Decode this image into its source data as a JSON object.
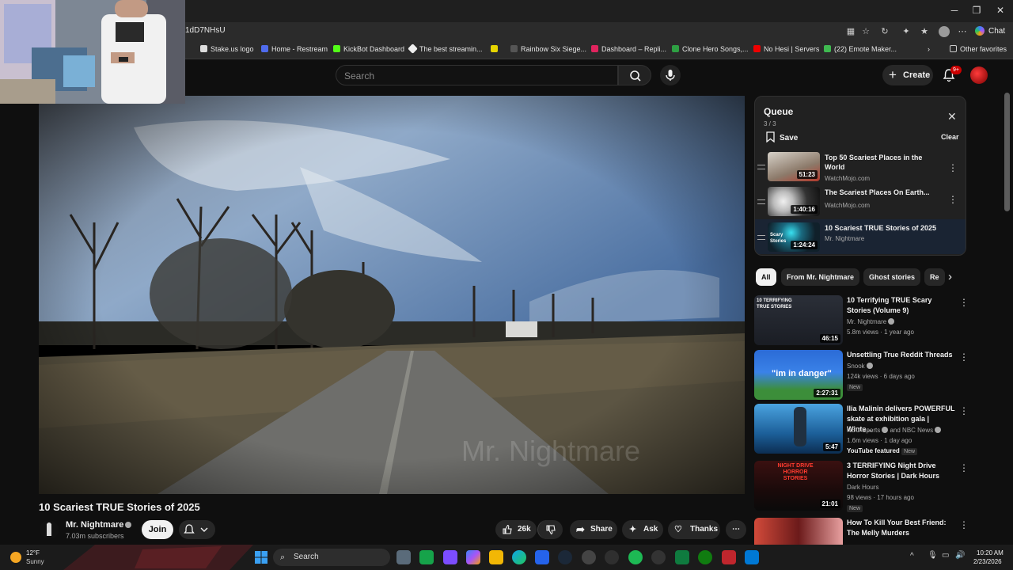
{
  "browser": {
    "url": "1dD7NHsU",
    "chat_label": "Chat",
    "bookmarks": [
      "Stake.us logo",
      "Home - Restream",
      "KickBot Dashboard",
      "The best streamin...",
      "Rainbow Six Siege...",
      "Dashboard – Repli...",
      "Clone Hero Songs,...",
      "No Hesi | Servers",
      "(22) Emote Maker...",
      "Other favorites"
    ]
  },
  "youtube": {
    "search_placeholder": "Search",
    "create_label": "Create",
    "notification_count": "9+"
  },
  "video": {
    "title": "10 Scariest TRUE Stories of 2025",
    "watermark": "Mr. Nightmare",
    "channel_name": "Mr. Nightmare",
    "subscribers": "7.03m subscribers",
    "join_label": "Join",
    "likes": "26k",
    "share_label": "Share",
    "ask_label": "Ask",
    "thanks_label": "Thanks"
  },
  "queue": {
    "title": "Queue",
    "count": "3 / 3",
    "save_label": "Save",
    "clear_label": "Clear",
    "items": [
      {
        "title": "Top 50 Scariest Places in the World",
        "channel": "WatchMojo.com",
        "duration": "51:23"
      },
      {
        "title": "The Scariest Places On Earth...",
        "channel": "WatchMojo.com",
        "duration": "1:40:16"
      },
      {
        "title": "10 Scariest TRUE Stories of 2025",
        "channel": "Mr. Nightmare",
        "duration": "1:24:24",
        "thumb_text": "Scary Stories"
      }
    ]
  },
  "chips": [
    "All",
    "From Mr. Nightmare",
    "Ghost stories",
    "Re"
  ],
  "recommendations": [
    {
      "title": "10 Terrifying TRUE Scary Stories (Volume 9)",
      "channel": "Mr. Nightmare",
      "meta": "5.8m views · 1 year ago",
      "duration": "46:15",
      "thumb_text": "10 TERRIFYING TRUE STORIES"
    },
    {
      "title": "Unsettling True Reddit Threads",
      "channel": "Snook",
      "meta": "124k views · 6 days ago",
      "badge": "New",
      "duration": "2:27:31",
      "thumb_text": "\"im in danger\""
    },
    {
      "title": "Ilia Malinin delivers POWERFUL skate at exhibition gala | Winte...",
      "channel": "NBC Sports",
      "channel_extra": "and NBC News",
      "meta": "1.6m views · 1 day ago",
      "badge_label": "YouTube featured",
      "badge": "New",
      "duration": "5:47"
    },
    {
      "title": "3 TERRIFYING Night Drive Horror Stories | Dark Hours",
      "channel": "Dark Hours",
      "meta": "98 views · 17 hours ago",
      "badge": "New",
      "duration": "21:01",
      "thumb_text": "NIGHT DRIVE HORROR STORIES"
    },
    {
      "title": "How To Kill Your Best Friend: The Melly Murders",
      "channel": "",
      "meta": ""
    }
  ],
  "taskbar": {
    "temperature": "12°F",
    "condition": "Sunny",
    "search_label": "Search",
    "time": "10:20 AM",
    "date": "2/23/2026"
  },
  "colors": {
    "background": "#0f0f0f",
    "queue_active": "#1a2433",
    "accent_red": "#cc0000"
  }
}
